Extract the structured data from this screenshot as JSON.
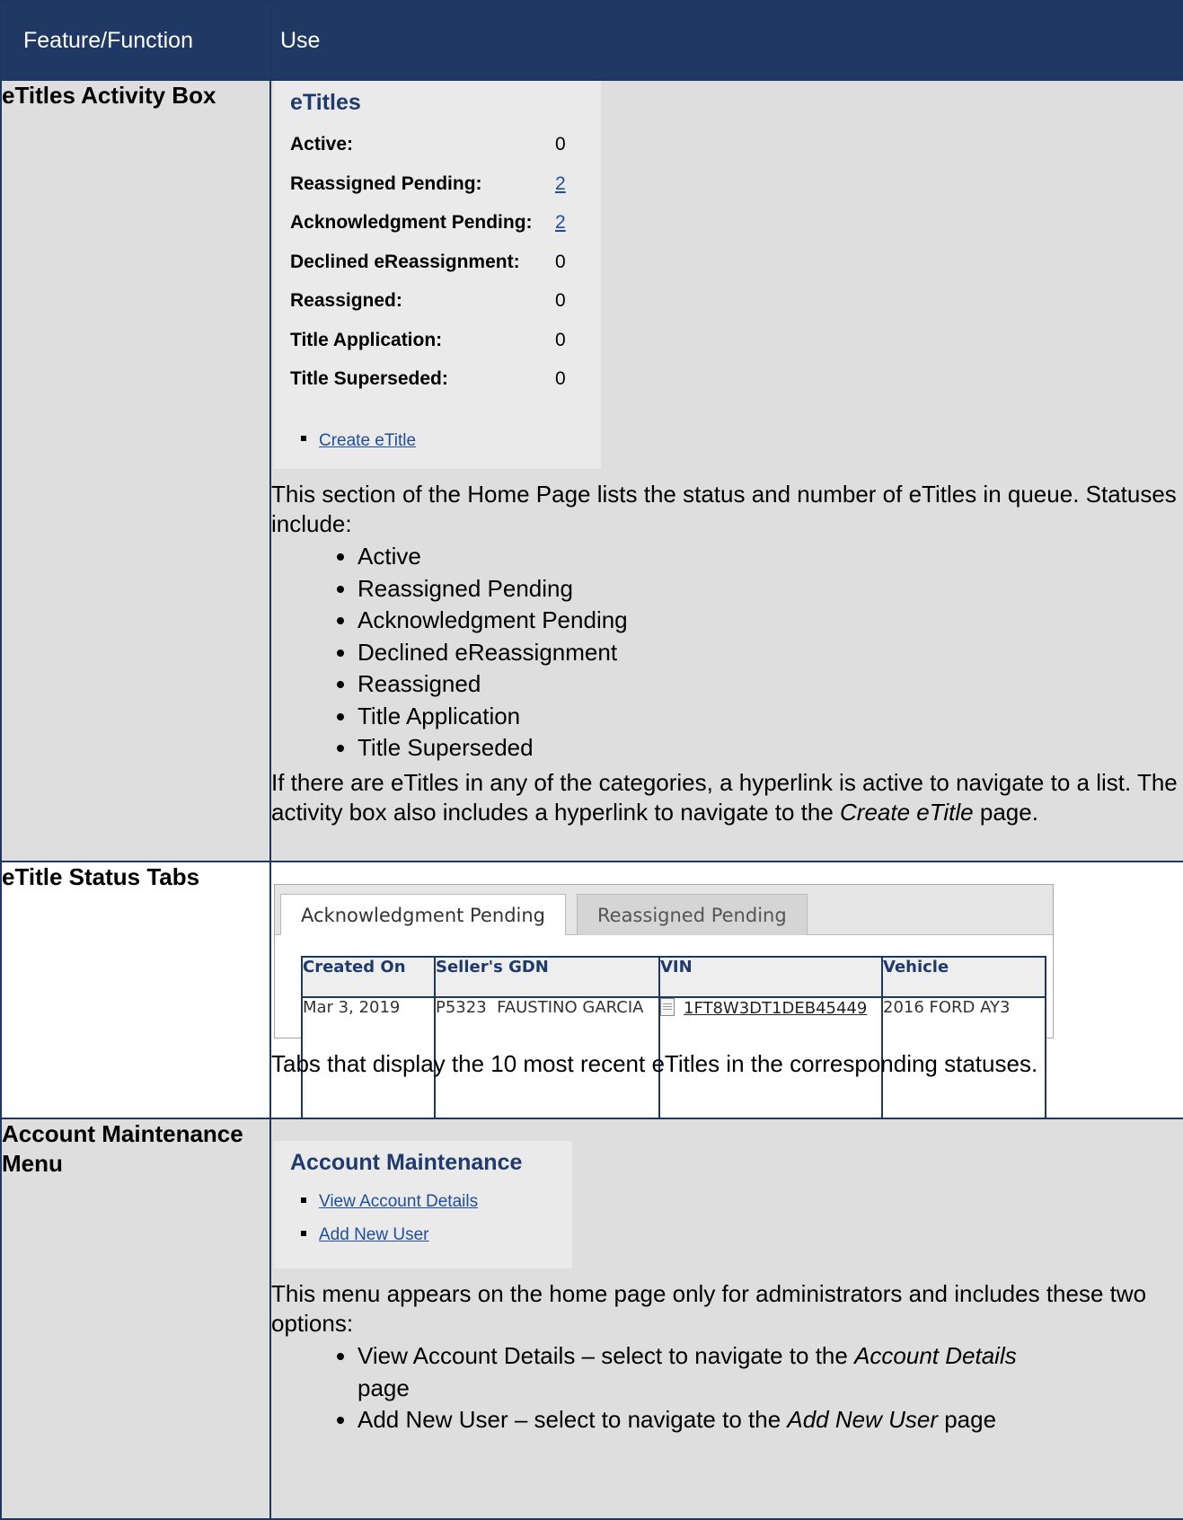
{
  "header": {
    "col1": "Feature/Function",
    "col2": "Use"
  },
  "row1": {
    "feature": "eTitles Activity Box",
    "box": {
      "title": "eTitles",
      "stats": [
        {
          "label": "Active:",
          "count": "0",
          "link": false
        },
        {
          "label": "Reassigned Pending:",
          "count": "2",
          "link": true
        },
        {
          "label": "Acknowledgment Pending:",
          "count": "2",
          "link": true
        },
        {
          "label": "Declined eReassignment:",
          "count": "0",
          "link": false
        },
        {
          "label": "Reassigned:",
          "count": "0",
          "link": false
        },
        {
          "label": "Title Application:",
          "count": "0",
          "link": false
        },
        {
          "label": "Title Superseded:",
          "count": "0",
          "link": false
        }
      ],
      "create_link": "Create eTitle"
    },
    "intro": "This section of the Home Page lists the status and number of eTitles in queue. Statuses include:",
    "bullets": [
      "Active",
      "Reassigned Pending",
      "Acknowledgment Pending",
      "Declined eReassignment",
      "Reassigned",
      "Title Application",
      "Title Superseded"
    ],
    "outro_a": "If there are eTitles in any of the categories, a hyperlink is active to navigate to a list. The activity box also includes a hyperlink to navigate to the ",
    "outro_em": "Create eTitle",
    "outro_b": " page."
  },
  "row2": {
    "feature": "eTitle Status Tabs",
    "tabs": {
      "active": "Acknowledgment Pending",
      "inactive": "Reassigned Pending"
    },
    "grid": {
      "headers": [
        "Created On",
        "Seller's GDN",
        "VIN",
        "Vehicle"
      ],
      "row": {
        "created": "Mar 3, 2019",
        "seller": "P5323  FAUSTINO GARCIA",
        "vin": "1FT8W3DT1DEB45449",
        "vehicle": "2016 FORD AY3"
      }
    },
    "desc": "Tabs that display the 10 most recent eTitles in the corresponding statuses."
  },
  "row3": {
    "feature": "Account Maintenance Menu",
    "box": {
      "title": "Account Maintenance",
      "links": [
        "View Account Details",
        "Add New User"
      ]
    },
    "intro": "This menu appears on the home page only for administrators and includes these two options:",
    "bullets": [
      {
        "a": "View Account Details – select to navigate to the ",
        "em": "Account Details",
        "b": " page"
      },
      {
        "a": "Add New User – select to navigate to the ",
        "em": "Add New User",
        "b": " page"
      }
    ]
  }
}
